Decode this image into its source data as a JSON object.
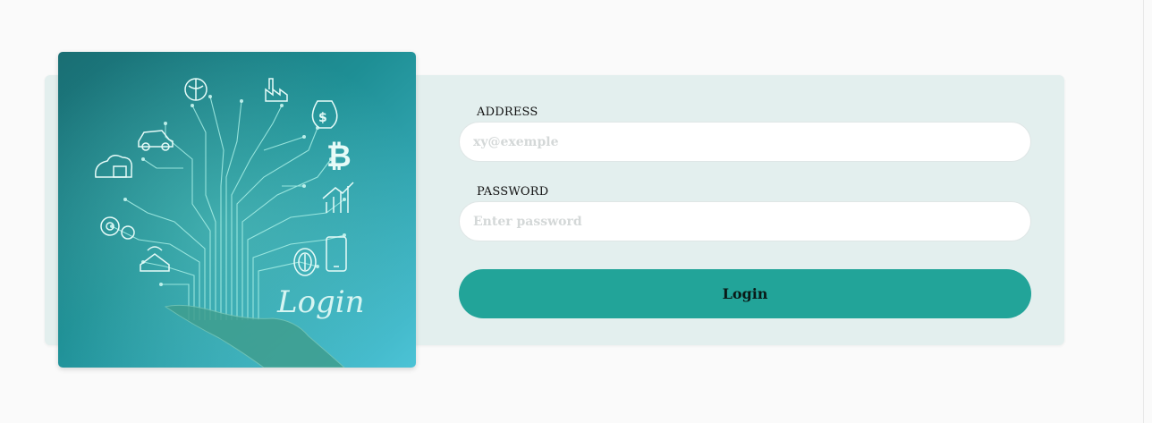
{
  "hero": {
    "image_text": "Login",
    "icons": [
      "brain-icon",
      "factory-icon",
      "money-bag-icon",
      "bitcoin-icon",
      "car-icon",
      "cloud-lock-icon",
      "chart-growth-icon",
      "gears-icon",
      "wifi-home-icon",
      "fingerprint-icon",
      "smartphone-icon",
      "hand-icon"
    ]
  },
  "form": {
    "address": {
      "label": "ADDRESS",
      "placeholder": "xy@exemple",
      "value": ""
    },
    "password": {
      "label": "PASSWORD",
      "placeholder": "Enter password",
      "value": ""
    },
    "login_label": "Login"
  },
  "colors": {
    "page_background": "#fafafa",
    "card_background": "#e3efee",
    "button": "#22a499",
    "hero_teal": "#1f8d94"
  }
}
